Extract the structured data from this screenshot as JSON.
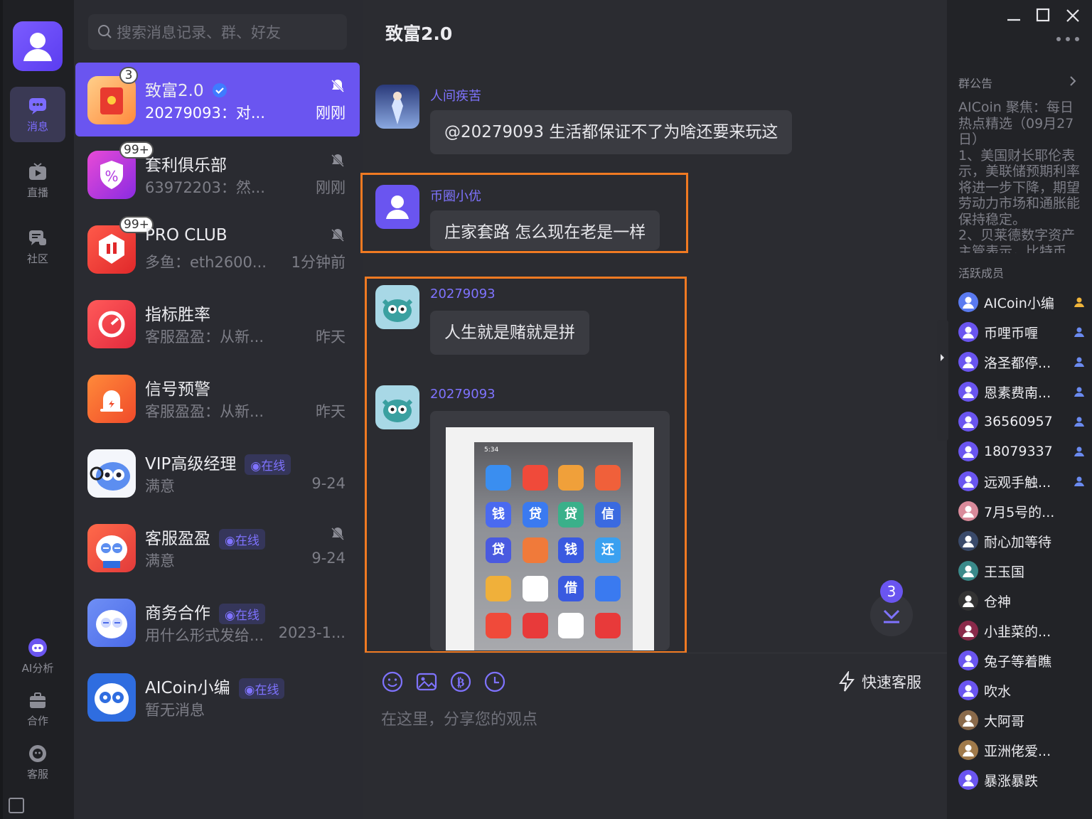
{
  "nav": {
    "items": [
      {
        "label": "消息",
        "icon": "chat-bubble-icon"
      },
      {
        "label": "直播",
        "icon": "live-tv-icon"
      },
      {
        "label": "社区",
        "icon": "community-icon"
      },
      {
        "label": "AI分析",
        "icon": "ai-robot-icon"
      },
      {
        "label": "合作",
        "icon": "briefcase-icon"
      },
      {
        "label": "客服",
        "icon": "support-icon"
      }
    ]
  },
  "search": {
    "placeholder": "搜索消息记录、群、好友"
  },
  "conversations": [
    {
      "name": "致富2.0",
      "preview": "20279093：对...",
      "time": "刚刚",
      "badge": "3",
      "verified": true,
      "muted": true,
      "online": ""
    },
    {
      "name": "套利俱乐部",
      "preview": "63972203：然...",
      "time": "刚刚",
      "badge": "99+",
      "muted": true,
      "online": ""
    },
    {
      "name": "PRO CLUB",
      "preview": "多鱼：eth2600...",
      "time": "1分钟前",
      "badge": "99+",
      "muted": true,
      "online": ""
    },
    {
      "name": "指标胜率",
      "preview": "客服盈盈：从新...",
      "time": "昨天",
      "badge": "",
      "muted": false,
      "online": ""
    },
    {
      "name": "信号预警",
      "preview": "客服盈盈：从新...",
      "time": "昨天",
      "badge": "",
      "muted": false,
      "online": ""
    },
    {
      "name": "VIP高级经理",
      "preview": "满意",
      "time": "9-24",
      "badge": "",
      "muted": false,
      "online": "◉在线"
    },
    {
      "name": "客服盈盈",
      "preview": "满意",
      "time": "9-24",
      "badge": "",
      "muted": true,
      "online": "◉在线"
    },
    {
      "name": "商务合作",
      "preview": "用什么形式发给...",
      "time": "2023-1...",
      "badge": "",
      "muted": false,
      "online": "◉在线"
    },
    {
      "name": "AICoin小编",
      "preview": "暂无消息",
      "time": "",
      "badge": "",
      "muted": false,
      "online": "◉在线"
    }
  ],
  "chat": {
    "title": "致富2.0",
    "messages": [
      {
        "sender": "人间疾苦",
        "text": "@20279093  生活都保证不了为啥还要来玩这"
      },
      {
        "sender": "币圈小优",
        "text": "庄家套路 怎么现在老是一样"
      },
      {
        "sender": "20279093",
        "text": "人生就是赌就是拼"
      },
      {
        "sender": "20279093",
        "text": ""
      }
    ],
    "unread_jump": "3",
    "quick_service": "快速客服",
    "input_placeholder": "在这里，分享您的观点",
    "phone_time": "5:34"
  },
  "sidebar": {
    "notice_title": "群公告",
    "notice_text": "AICoin 聚焦：每日热点精选（09月27日）\n1、美国财长耶伦表示，美联储预期利率将进一步下降，期望劳动力市场和通胀能保持稳定。\n2、贝莱德数字资产主管表示，比特币",
    "members_title": "活跃成员",
    "members": [
      {
        "name": "AICoin小编",
        "role": "admin"
      },
      {
        "name": "币哩币喱",
        "role": "member"
      },
      {
        "name": "洛圣都停...",
        "role": "member"
      },
      {
        "name": "恩素费南...",
        "role": "member"
      },
      {
        "name": "36560957",
        "role": "member"
      },
      {
        "name": "18079337",
        "role": "member"
      },
      {
        "name": "远观手触...",
        "role": "member"
      },
      {
        "name": "7月5号的...",
        "role": ""
      },
      {
        "name": "耐心加等待",
        "role": ""
      },
      {
        "name": "王玉国",
        "role": ""
      },
      {
        "name": "仓神",
        "role": ""
      },
      {
        "name": "小韭菜的...",
        "role": ""
      },
      {
        "name": "兔子等着瞧",
        "role": ""
      },
      {
        "name": "吹水",
        "role": ""
      },
      {
        "name": "大阿哥",
        "role": ""
      },
      {
        "name": "亚洲佬爱...",
        "role": ""
      },
      {
        "name": "暴涨暴跌",
        "role": ""
      }
    ]
  },
  "colors": {
    "accent": "#6a55f0",
    "highlight": "#f07a22",
    "name": "#7f73ff"
  }
}
